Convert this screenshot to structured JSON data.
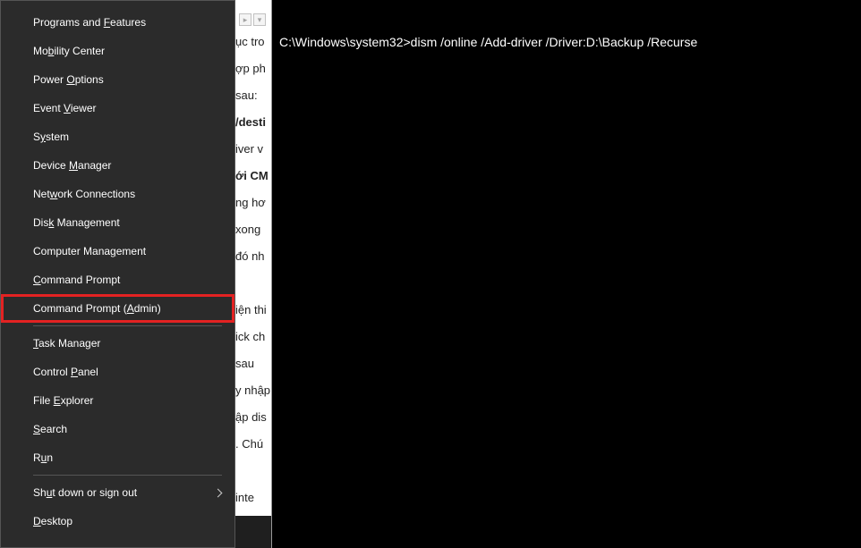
{
  "menu": {
    "items": [
      {
        "pre": "Programs and ",
        "u": "F",
        "post": "eatures"
      },
      {
        "pre": "Mo",
        "u": "b",
        "post": "ility Center"
      },
      {
        "pre": "Power ",
        "u": "O",
        "post": "ptions"
      },
      {
        "pre": "Event ",
        "u": "V",
        "post": "iewer"
      },
      {
        "pre": "S",
        "u": "y",
        "post": "stem"
      },
      {
        "pre": "Device ",
        "u": "M",
        "post": "anager"
      },
      {
        "pre": "Net",
        "u": "w",
        "post": "ork Connections"
      },
      {
        "pre": "Dis",
        "u": "k",
        "post": " Management"
      },
      {
        "pre": "Computer Mana",
        "u": "g",
        "post": "ement"
      },
      {
        "pre": "",
        "u": "C",
        "post": "ommand Prompt"
      },
      {
        "pre": "Command Prompt (",
        "u": "A",
        "post": "dmin)"
      }
    ],
    "section2": [
      {
        "pre": "",
        "u": "T",
        "post": "ask Manager"
      },
      {
        "pre": "Control ",
        "u": "P",
        "post": "anel"
      },
      {
        "pre": "File ",
        "u": "E",
        "post": "xplorer"
      },
      {
        "pre": "",
        "u": "S",
        "post": "earch"
      },
      {
        "pre": "R",
        "u": "u",
        "post": "n"
      }
    ],
    "section3": [
      {
        "pre": "Sh",
        "u": "u",
        "post": "t down or sign out",
        "chevron": true
      },
      {
        "pre": "",
        "u": "D",
        "post": "esktop"
      }
    ]
  },
  "middle": {
    "fragments": [
      {
        "text": "ục tro",
        "bold": false
      },
      {
        "text": "ợp ph",
        "bold": false
      },
      {
        "text": " sau:",
        "bold": false
      },
      {
        "text": "/desti",
        "bold": true
      },
      {
        "text": "iver v",
        "bold": false
      },
      {
        "text": "ới CM",
        "bold": true
      },
      {
        "text": "ng hơ",
        "bold": false
      },
      {
        "text": " xong",
        "bold": false
      },
      {
        "text": " đó nh",
        "bold": false
      },
      {
        "text": "",
        "bold": false
      },
      {
        "text": "iện thi",
        "bold": false
      },
      {
        "text": "ick ch",
        "bold": false
      },
      {
        "text": " sau ",
        "bold": false
      },
      {
        "text": "y nhập",
        "bold": false
      },
      {
        "text": "ập dis",
        "bold": false
      },
      {
        "text": ". Chú",
        "bold": false
      },
      {
        "text": "",
        "bold": false
      },
      {
        "text": " inte",
        "bold": false
      }
    ]
  },
  "terminal": {
    "prompt_path": "C:\\Windows\\system32>",
    "command": "dism /online /Add-driver /Driver:D:\\Backup /Recurse"
  }
}
